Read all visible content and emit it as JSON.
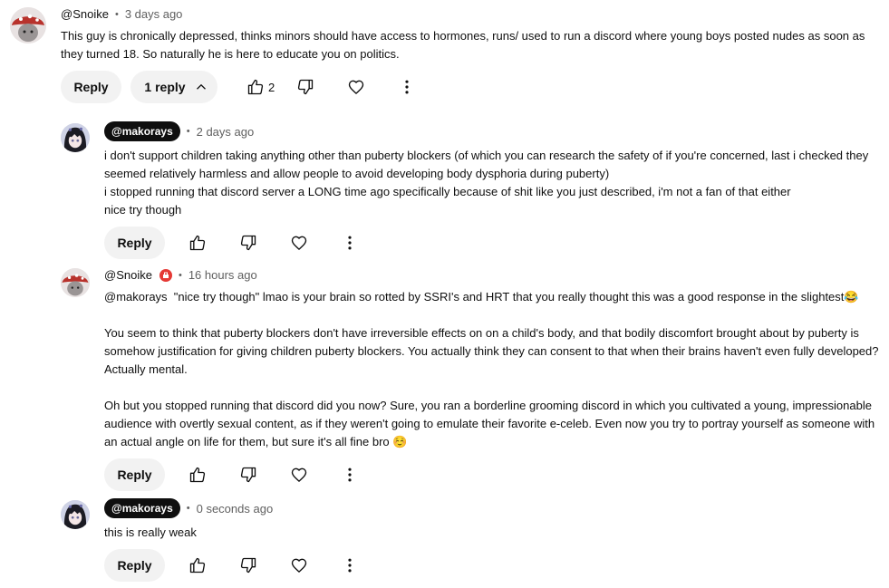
{
  "comments": [
    {
      "handle": "@Snoike",
      "time": "3 days ago",
      "text": "This guy is chronically depressed, thinks minors should have access to hormones, runs/ used to run a discord where young boys posted nudes as soon as\nthey turned 18. So naturally he is here to educate you on politics.",
      "reply_label": "Reply",
      "replies_toggle": "1 reply",
      "like_count": "2"
    },
    {
      "handle": "@makorays",
      "time": "2 days ago",
      "text": "i don't support children taking anything other than puberty blockers (of which you can research the safety of if you're concerned, last i checked they\nseemed relatively harmless and allow people to avoid developing body dysphoria during puberty)\ni stopped running that discord server a LONG time ago specifically because of shit like you just described, i'm not a fan of that either\nnice try though",
      "reply_label": "Reply"
    },
    {
      "handle": "@Snoike",
      "time": "16 hours ago",
      "text": "@makorays  \"nice try though\" lmao is your brain so rotted by SSRI's and HRT that you really thought this was a good response in the slightest😂\n\nYou seem to think that puberty blockers don't have irreversible effects on on a child's body, and that bodily discomfort brought about by puberty is\nsomehow justification for giving children puberty blockers. You actually think they can consent to that when their brains haven't even fully developed?\nActually mental.\n\nOh but you stopped running that discord did you now? Sure, you ran a borderline grooming discord in which you cultivated a young, impressionable\naudience with overtly sexual content, as if they weren't going to emulate their favorite e-celeb. Even now you try to portray yourself as someone with\nan actual angle on life for them, but sure it's all fine bro ☺️",
      "reply_label": "Reply"
    },
    {
      "handle": "@makorays",
      "time": "0 seconds ago",
      "text": "this is really weak",
      "reply_label": "Reply"
    }
  ],
  "separator": "•",
  "icons": {
    "like": "thumbs-up-icon",
    "dislike": "thumbs-down-icon",
    "heart": "heart-icon",
    "more": "more-vert-icon",
    "chevron": "chevron-up-icon",
    "badge": "member-badge-icon"
  }
}
